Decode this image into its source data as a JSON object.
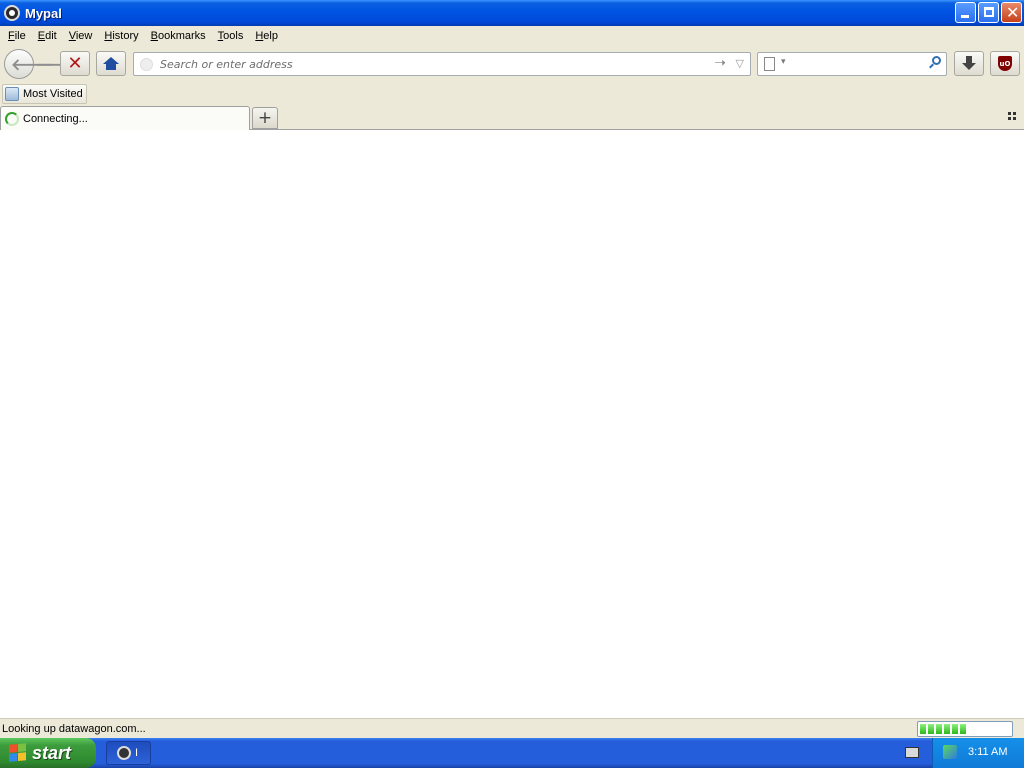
{
  "window": {
    "title": "Mypal"
  },
  "menu": [
    "File",
    "Edit",
    "View",
    "History",
    "Bookmarks",
    "Tools",
    "Help"
  ],
  "navbar": {
    "url_placeholder": "Search or enter address",
    "search_placeholder": ""
  },
  "bookmarks": [
    {
      "label": "Most Visited"
    }
  ],
  "tabs": [
    {
      "label": "Connecting..."
    }
  ],
  "status": {
    "text": "Looking up datawagon.com...",
    "progress_fraction": 0.55
  },
  "taskbar": {
    "start_label": "start",
    "task_label": "I",
    "clock": "3:11 AM"
  },
  "colors": {
    "titlebar": "#0054e3",
    "taskbar": "#245edb",
    "start": "#3c9b3c",
    "tray": "#0f7ad8"
  }
}
